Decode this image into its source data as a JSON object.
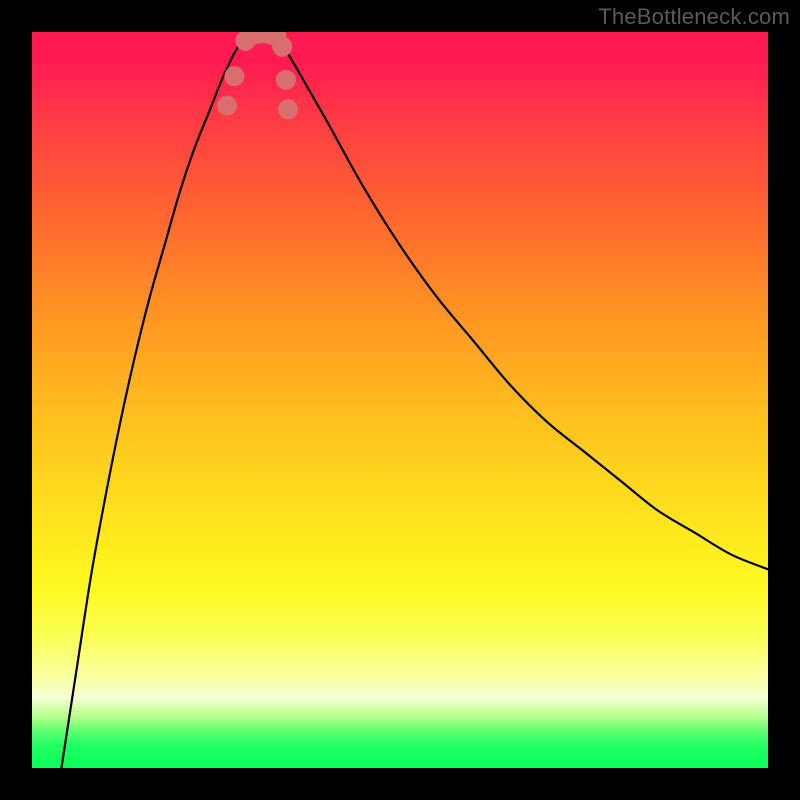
{
  "watermark": {
    "text": "TheBottleneck.com"
  },
  "colors": {
    "frame": "#000000",
    "curve": "#000000",
    "marker_fill": "#d96e6e",
    "marker_stroke": "#be5757",
    "gradient_top": "#ff1a52",
    "gradient_bottom": "#0aff59"
  },
  "chart_data": {
    "type": "line",
    "title": "",
    "xlabel": "",
    "ylabel": "",
    "xlim": [
      0,
      100
    ],
    "ylim": [
      0,
      100
    ],
    "grid": false,
    "legend": false,
    "notes": "Bottleneck-style V-curve. Y axis is inverted visually (high values plotted near top). Minimum (best match) occurs around x≈30–33 where y≈0. Left branch rises steeply toward 100 near x=4; right branch rises toward ~73 at x=100.",
    "series": [
      {
        "name": "left-branch",
        "x": [
          4,
          6,
          8,
          10,
          12,
          14,
          16,
          18,
          20,
          22,
          24,
          26,
          28,
          30
        ],
        "y": [
          100,
          87,
          74,
          63,
          53,
          44,
          36,
          29,
          22,
          16,
          11,
          6,
          2,
          0
        ]
      },
      {
        "name": "right-branch",
        "x": [
          33,
          36,
          40,
          45,
          50,
          55,
          60,
          65,
          70,
          75,
          80,
          85,
          90,
          95,
          100
        ],
        "y": [
          0,
          5,
          12,
          21,
          29,
          36,
          42,
          48,
          53,
          57,
          61,
          65,
          68,
          71,
          73
        ]
      }
    ],
    "markers": {
      "name": "highlight-points",
      "color": "#d96e6e",
      "shape": "round",
      "x": [
        26.5,
        27.5,
        29.0,
        30.0,
        31.0,
        32.2,
        33.2,
        34.0,
        34.5,
        34.8
      ],
      "y": [
        10.0,
        6.0,
        1.2,
        0.4,
        0.2,
        0.3,
        0.6,
        2.0,
        6.5,
        10.5
      ]
    }
  }
}
